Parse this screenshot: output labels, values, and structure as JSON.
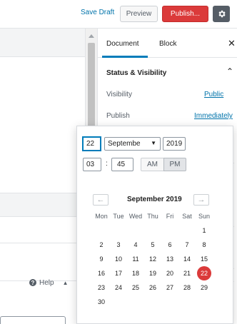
{
  "header": {
    "save_draft": "Save Draft",
    "preview": "Preview",
    "publish": "Publish...",
    "settings_icon": "gear-icon"
  },
  "editor": {
    "help_label": "Help"
  },
  "sidebar": {
    "tabs": [
      {
        "label": "Document",
        "active": true
      },
      {
        "label": "Block",
        "active": false
      }
    ],
    "close_icon": "close-icon",
    "panel": {
      "title": "Status & Visibility",
      "visibility_label": "Visibility",
      "visibility_value": "Public",
      "publish_label": "Publish",
      "publish_value": "Immediately"
    }
  },
  "datepicker": {
    "day": "22",
    "month": "Septembe",
    "year": "2019",
    "hour": "03",
    "minute": "45",
    "am": "AM",
    "pm": "PM",
    "meridiem_selected": "PM",
    "month_title": "September 2019",
    "prev_icon": "arrow-left-icon",
    "next_icon": "arrow-right-icon",
    "weekdays": [
      "Mon",
      "Tue",
      "Wed",
      "Thu",
      "Fri",
      "Sat",
      "Sun"
    ],
    "weeks": [
      [
        "",
        "",
        "",
        "",
        "",
        "",
        "1"
      ],
      [
        "2",
        "3",
        "4",
        "5",
        "6",
        "7",
        "8"
      ],
      [
        "9",
        "10",
        "11",
        "12",
        "13",
        "14",
        "15"
      ],
      [
        "16",
        "17",
        "18",
        "19",
        "20",
        "21",
        "22"
      ],
      [
        "23",
        "24",
        "25",
        "26",
        "27",
        "28",
        "29"
      ],
      [
        "30",
        "",
        "",
        "",
        "",
        "",
        ""
      ]
    ],
    "selected_day": "22"
  },
  "colors": {
    "accent": "#007cba",
    "link": "#0073aa",
    "publish": "#db3a3a"
  }
}
